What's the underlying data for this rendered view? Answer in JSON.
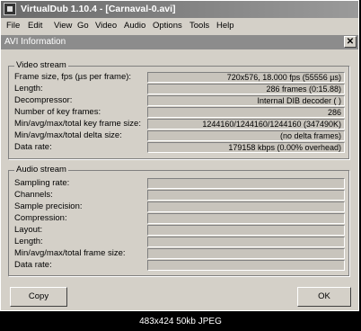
{
  "window": {
    "title": "VirtualDub 1.10.4 - [Carnaval-0.avi]"
  },
  "menu": [
    "File",
    "Edit",
    "View",
    "Go",
    "Video",
    "Audio",
    "Options",
    "Tools",
    "Help"
  ],
  "dialog": {
    "title": "AVI Information",
    "close_glyph": "✕"
  },
  "video_stream": {
    "legend": "Video stream",
    "rows": [
      {
        "label": "Frame size, fps (µs per frame):",
        "value": "720x576, 18.000 fps (55556 µs)"
      },
      {
        "label": "Length:",
        "value": "286 frames (0:15.88)"
      },
      {
        "label": "Decompressor:",
        "value": "Internal DIB decoder (   )"
      },
      {
        "label": "Number of key frames:",
        "value": "286"
      },
      {
        "label": "Min/avg/max/total key frame size:",
        "value": "1244160/1244160/1244160 (347490K)"
      },
      {
        "label": "Min/avg/max/total delta size:",
        "value": "(no delta frames)"
      },
      {
        "label": "Data rate:",
        "value": "179158 kbps (0.00% overhead)"
      }
    ]
  },
  "audio_stream": {
    "legend": "Audio stream",
    "rows": [
      {
        "label": "Sampling rate:",
        "value": ""
      },
      {
        "label": "Channels:",
        "value": ""
      },
      {
        "label": "Sample precision:",
        "value": ""
      },
      {
        "label": "Compression:",
        "value": ""
      },
      {
        "label": "Layout:",
        "value": ""
      },
      {
        "label": "Length:",
        "value": ""
      },
      {
        "label": "Min/avg/max/total frame size:",
        "value": ""
      },
      {
        "label": "Data rate:",
        "value": ""
      }
    ]
  },
  "buttons": {
    "copy": "Copy",
    "ok": "OK"
  },
  "footer": "483x424  50kb  JPEG"
}
